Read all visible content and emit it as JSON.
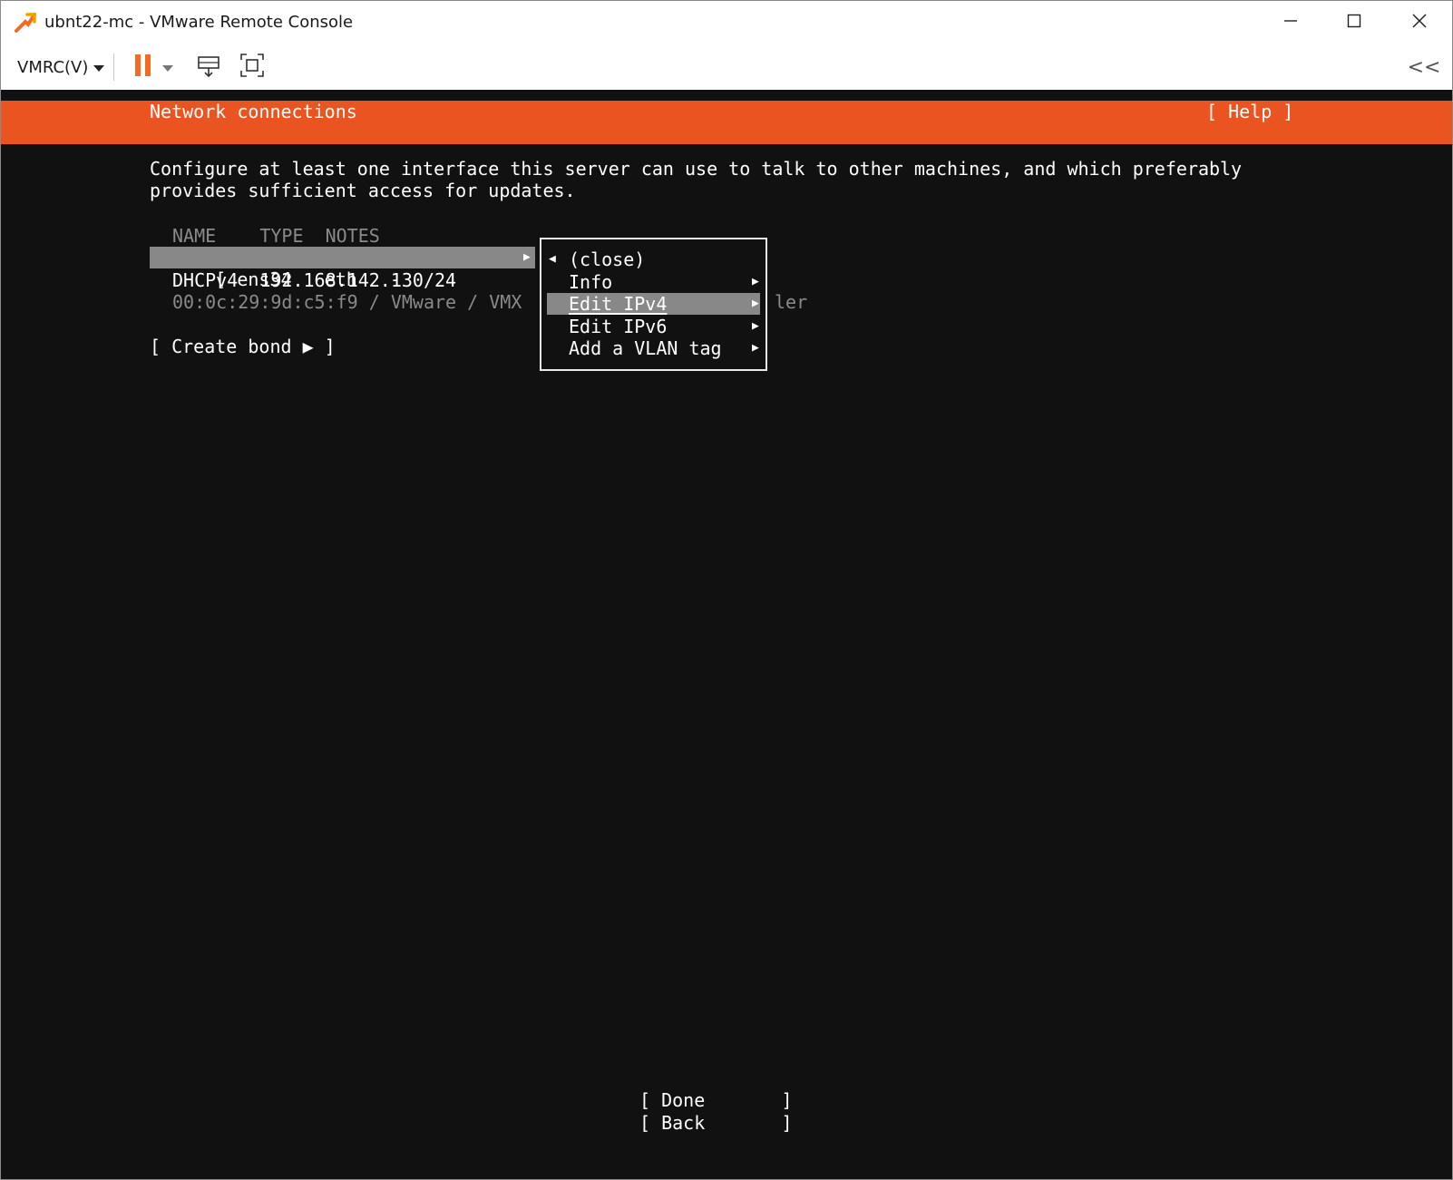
{
  "window": {
    "title": "ubnt22-mc - VMware Remote Console",
    "controls": {
      "minimize": "minimize-icon",
      "maximize": "maximize-icon",
      "close": "close-icon"
    }
  },
  "toolbar": {
    "vmrc_menu_label": "VMRC(V)",
    "pause_color": "#f26b21",
    "collapse_label": "<<"
  },
  "installer": {
    "accent_color": "#e95420",
    "page_title": "Network connections",
    "help_label": "[ Help ]",
    "description_lines": [
      "Configure at least one interface this server can use to talk to other machines, and which preferably",
      "provides sufficient access for updates."
    ],
    "table_header": "NAME    TYPE  NOTES",
    "interface": {
      "row_text": "[ ens34   eth   -",
      "dhcp_text": "DHCPv4  192.168.142.130/24",
      "mac_text": "00:0c:29:9d:c5:f9 / VMware / VMX",
      "mac_overflow": "ler"
    },
    "create_bond_label": "[ Create bond ▶ ]",
    "context_menu": {
      "items": [
        {
          "label": "(close)"
        },
        {
          "label": "Info"
        },
        {
          "label": "Edit IPv4"
        },
        {
          "label": "Edit IPv6"
        },
        {
          "label": "Add a VLAN tag"
        }
      ],
      "selected": "Edit IPv4"
    },
    "done_label": "[ Done       ]",
    "back_label": "[ Back       ]"
  }
}
